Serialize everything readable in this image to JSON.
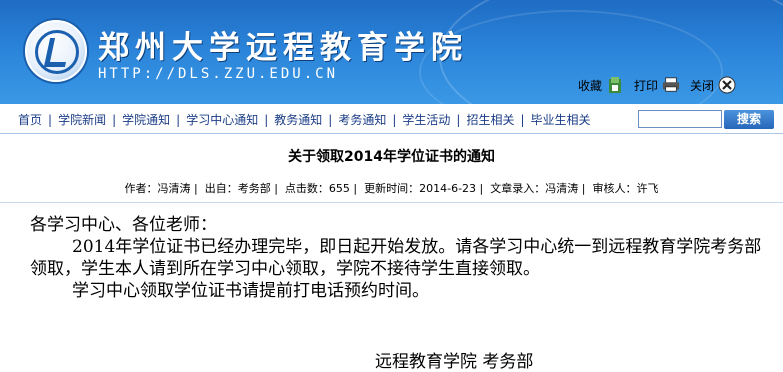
{
  "header": {
    "school_name": "郑州大学远程教育学院",
    "url_text": "HTTP://DLS.ZZU.EDU.CN",
    "tools": [
      {
        "label": "收藏",
        "icon": "bookmark-icon"
      },
      {
        "label": "打印",
        "icon": "printer-icon"
      },
      {
        "label": "关闭",
        "icon": "close-icon"
      }
    ]
  },
  "nav": {
    "items": [
      "首页",
      "学院新闻",
      "学院通知",
      "学习中心通知",
      "教务通知",
      "考务通知",
      "学生活动",
      "招生相关",
      "毕业生相关"
    ],
    "search_value": "",
    "search_button": "搜索"
  },
  "article": {
    "title": "关于领取2014年学位证书的通知",
    "meta": {
      "author": "作者：冯清涛",
      "source": "出自：考务部",
      "hits": "点击数：655",
      "updated": "更新时间：2014-6-23",
      "entered_by": "文章录入：冯清涛",
      "reviewer": "审核人：许飞"
    },
    "salutation": "各学习中心、各位老师：",
    "paragraph1": "2014年学位证书已经办理完毕，即日起开始发放。请各学习中心统一到远程教育学院考务部领取，学生本人请到所在学习中心领取，学院不接待学生直接领取。",
    "paragraph2": "学习中心领取学位证书请提前打电话预约时间。",
    "signature": "远程教育学院  考务部"
  }
}
